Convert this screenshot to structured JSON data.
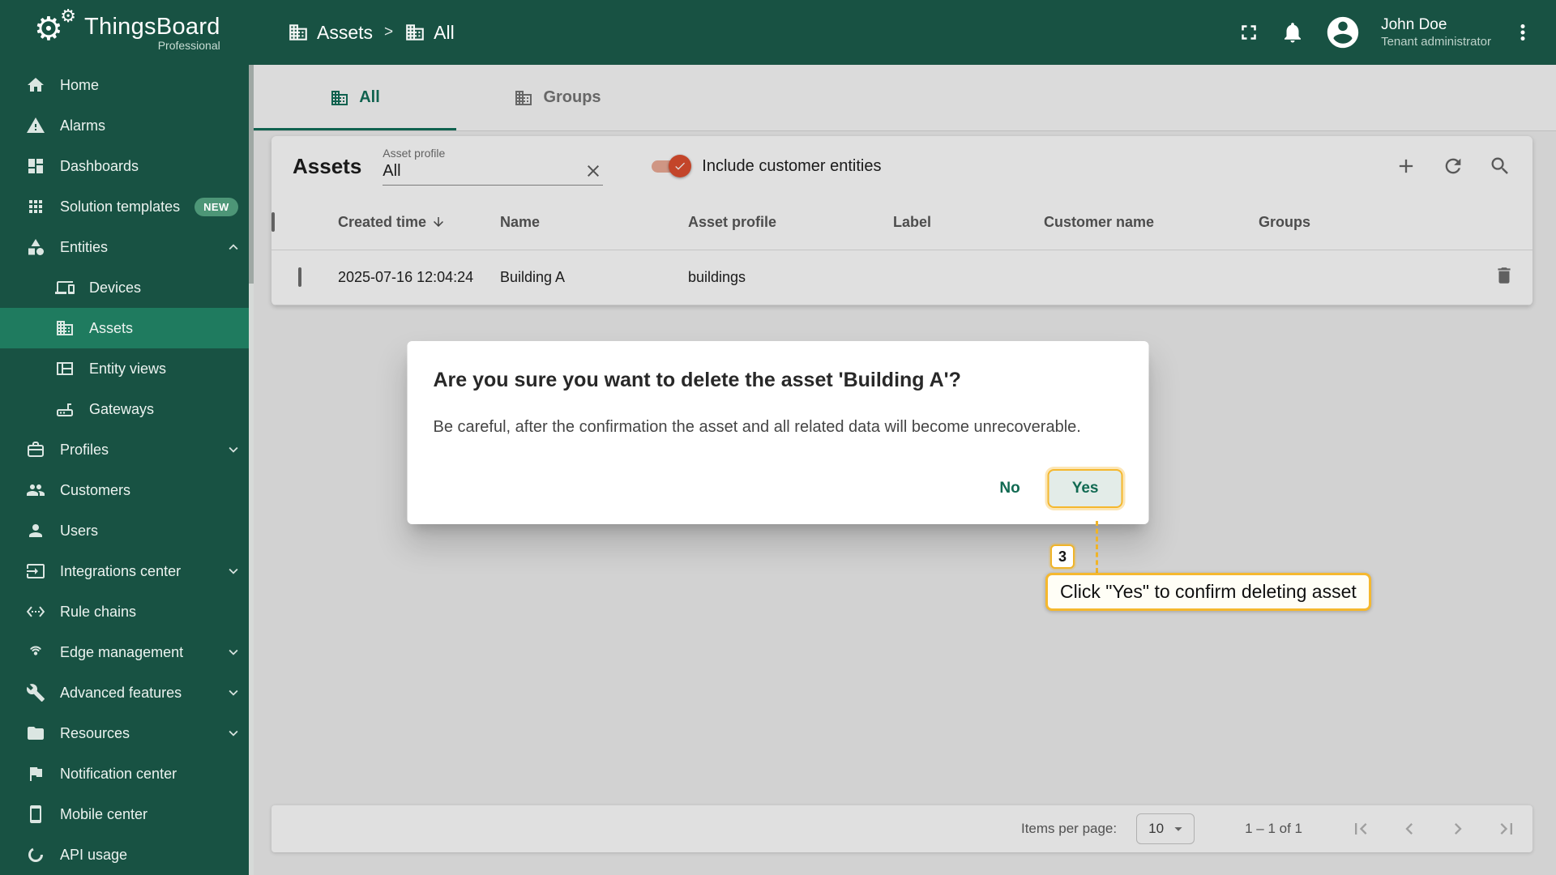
{
  "app": {
    "name": "ThingsBoard",
    "edition": "Professional"
  },
  "header": {
    "breadcrumb": {
      "root": "Assets",
      "separator": ">",
      "current": "All"
    },
    "user": {
      "name": "John Doe",
      "role": "Tenant administrator"
    }
  },
  "sidebar": {
    "items": [
      {
        "label": "Home",
        "icon": "home-icon"
      },
      {
        "label": "Alarms",
        "icon": "alarms-icon"
      },
      {
        "label": "Dashboards",
        "icon": "dashboards-icon"
      },
      {
        "label": "Solution templates",
        "icon": "solution-templates-icon",
        "badge": "NEW"
      },
      {
        "label": "Entities",
        "icon": "entities-icon",
        "state": "expanded"
      },
      {
        "label": "Devices",
        "icon": "devices-icon",
        "sub": true
      },
      {
        "label": "Assets",
        "icon": "assets-icon",
        "sub": true,
        "selected": true
      },
      {
        "label": "Entity views",
        "icon": "entity-views-icon",
        "sub": true
      },
      {
        "label": "Gateways",
        "icon": "gateways-icon",
        "sub": true
      },
      {
        "label": "Profiles",
        "icon": "profiles-icon",
        "state": "collapsed"
      },
      {
        "label": "Customers",
        "icon": "customers-icon"
      },
      {
        "label": "Users",
        "icon": "users-icon"
      },
      {
        "label": "Integrations center",
        "icon": "integrations-icon",
        "state": "collapsed"
      },
      {
        "label": "Rule chains",
        "icon": "rule-chains-icon"
      },
      {
        "label": "Edge management",
        "icon": "edge-management-icon",
        "state": "collapsed"
      },
      {
        "label": "Advanced features",
        "icon": "advanced-features-icon",
        "state": "collapsed"
      },
      {
        "label": "Resources",
        "icon": "resources-icon",
        "state": "collapsed"
      },
      {
        "label": "Notification center",
        "icon": "notification-center-icon"
      },
      {
        "label": "Mobile center",
        "icon": "mobile-center-icon"
      },
      {
        "label": "API usage",
        "icon": "api-usage-icon"
      }
    ]
  },
  "tabs": {
    "all": "All",
    "groups": "Groups"
  },
  "toolbar": {
    "title": "Assets",
    "filter_label": "Asset profile",
    "filter_value": "All",
    "toggle_label": "Include customer entities"
  },
  "table": {
    "columns": [
      "Created time",
      "Name",
      "Asset profile",
      "Label",
      "Customer name",
      "Groups"
    ],
    "rows": [
      {
        "created_time": "2025-07-16 12:04:24",
        "name": "Building A",
        "asset_profile": "buildings",
        "label": "",
        "customer_name": "",
        "groups": ""
      }
    ]
  },
  "dialog": {
    "title": "Are you sure you want to delete the asset 'Building A'?",
    "message": "Be careful, after the confirmation the asset and all related data will become unrecoverable.",
    "no_label": "No",
    "yes_label": "Yes"
  },
  "tutorial": {
    "step": "3",
    "tooltip": "Click \"Yes\" to confirm deleting asset"
  },
  "paginator": {
    "items_per_page_label": "Items per page:",
    "page_size": "10",
    "range": "1 – 1 of 1"
  },
  "colors": {
    "sidebar": "#185243",
    "selected_item": "#1f7b5f",
    "tab_active": "#13705a",
    "toggle": "#df4f30",
    "highlight": "#f5b82e"
  }
}
